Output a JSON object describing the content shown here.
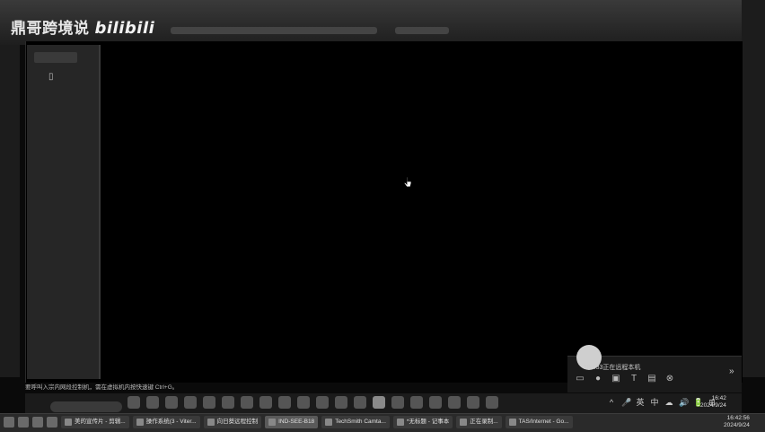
{
  "watermark": {
    "channel": "鼎哥跨境说",
    "brand": "bilibili"
  },
  "notification": {
    "text": "18...33正在远程本机",
    "expand_icon": "double-chevron-right-icon",
    "actions": [
      "chat-icon",
      "mic-icon",
      "screen-icon",
      "text-icon",
      "folder-icon",
      "close-circle-icon"
    ]
  },
  "status_line": "要呼叫入宗内网段控制机，需在虚拟机内按快速键 Ctrl+G。",
  "inner_clock": {
    "time": "16:42",
    "date": "2024/9/24"
  },
  "inner_tray": [
    "^",
    "🎤",
    "英",
    "中",
    "☁",
    "🔊",
    "🔋",
    "⊞"
  ],
  "host_taskbar": {
    "buttons": [
      "美的宣传片 - 剪辑...",
      "操作系统(3 - Viter...",
      "向日葵远程控制",
      "IND-SEE-B18",
      "TechSmith Camta...",
      "*无标题 - 记事本",
      "正在录制...",
      "TAS/Internet - Go..."
    ],
    "active_index": 3
  },
  "host_clock": {
    "time": "16:42:56",
    "date": "2024/9/24"
  }
}
